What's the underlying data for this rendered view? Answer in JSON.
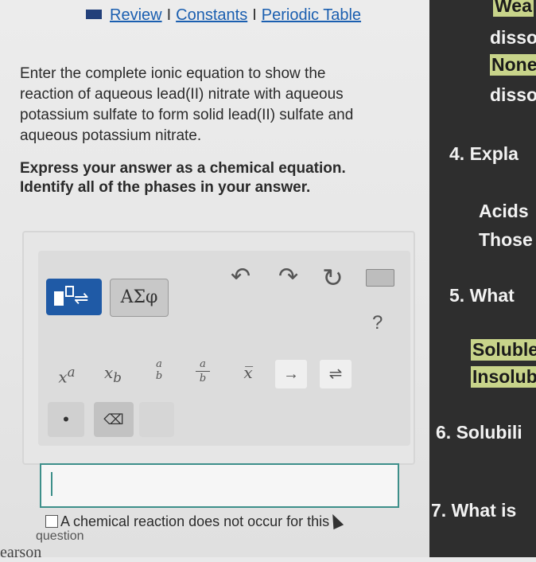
{
  "links": {
    "review": "Review",
    "constants": "Constants",
    "periodic": "Periodic Table",
    "sep": "I"
  },
  "prompt": "Enter the complete ionic equation to show the reaction of aqueous lead(II) nitrate with aqueous potassium sulfate to form solid lead(II) sulfate and aqueous potassium nitrate.",
  "instructions": "Express your answer as a chemical equation. Identify all of the phases in your answer.",
  "toolbar": {
    "greek": "ΑΣφ",
    "undo": "↶",
    "redo": "↷",
    "reset": "↻",
    "help": "?",
    "eq_sym": "⇌"
  },
  "symbols": {
    "superscript": "x",
    "superscript_a": "a",
    "subscript": "x",
    "subscript_b": "b",
    "frac_a": "a",
    "frac_b": "b",
    "xbar": "x̅",
    "arrow": "→",
    "equilibrium": "⇌",
    "dot": "•",
    "delete": "⌫"
  },
  "no_reaction_label": "A chemical reaction does not occur for this",
  "question_word": "question",
  "pearson": "earson",
  "sidebar": {
    "l1": "Wea",
    "l2": "disso",
    "l3": "None",
    "l4": "disso",
    "q4": "4.  Expla",
    "acids": "Acids",
    "those": "Those",
    "q5": "5.  What",
    "soluble": "Soluble",
    "insoluble": "Insolub",
    "q6": "6.  Solubili",
    "q7": "7.  What is"
  },
  "colors": {
    "link": "#1b5fb0",
    "tmpl_button": "#1f5aa6",
    "answer_border": "#3d8f8a",
    "highlight": "#c8d48a"
  }
}
